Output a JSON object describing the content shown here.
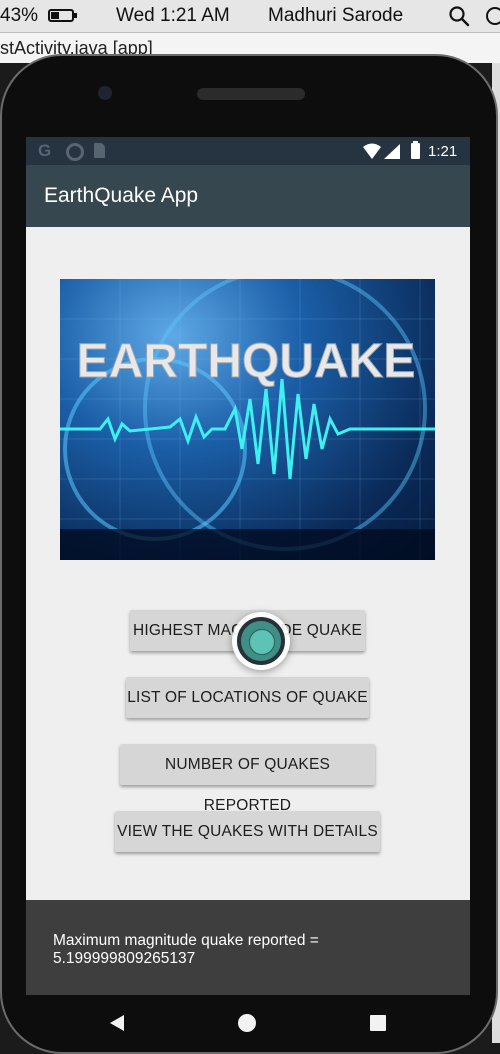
{
  "mac_menubar": {
    "battery_percent": "43%",
    "clock": "Wed 1:21 AM",
    "user_name": "Madhuri Sarode",
    "icons": [
      "battery-icon",
      "search-icon",
      "toggle-icon"
    ]
  },
  "ide_tab_fragment": "stActivity.java [app]",
  "status_bar": {
    "time": "1:21",
    "left_icons": [
      "g-icon",
      "circle-icon",
      "sd-card-icon"
    ],
    "right_icons": [
      "wifi-icon",
      "signal-icon",
      "battery-icon"
    ]
  },
  "app_bar": {
    "title": "EarthQuake App",
    "color": "#37474f"
  },
  "hero_image": {
    "text": "EARTHQUAKE",
    "description_icon": "earthquake-banner"
  },
  "buttons": [
    {
      "label": "HIGHEST MAGNITUDE QUAKE"
    },
    {
      "label": "LIST OF LOCATIONS OF QUAKE"
    },
    {
      "label": "NUMBER OF QUAKES REPORTED"
    },
    {
      "label": "VIEW THE QUAKES WITH DETAILS"
    }
  ],
  "toast": {
    "line1": "Maximum magnitude quake reported =",
    "line2": "5.199999809265137"
  },
  "nav_bar": {
    "icons": [
      "back-icon",
      "home-icon",
      "recents-icon"
    ]
  }
}
